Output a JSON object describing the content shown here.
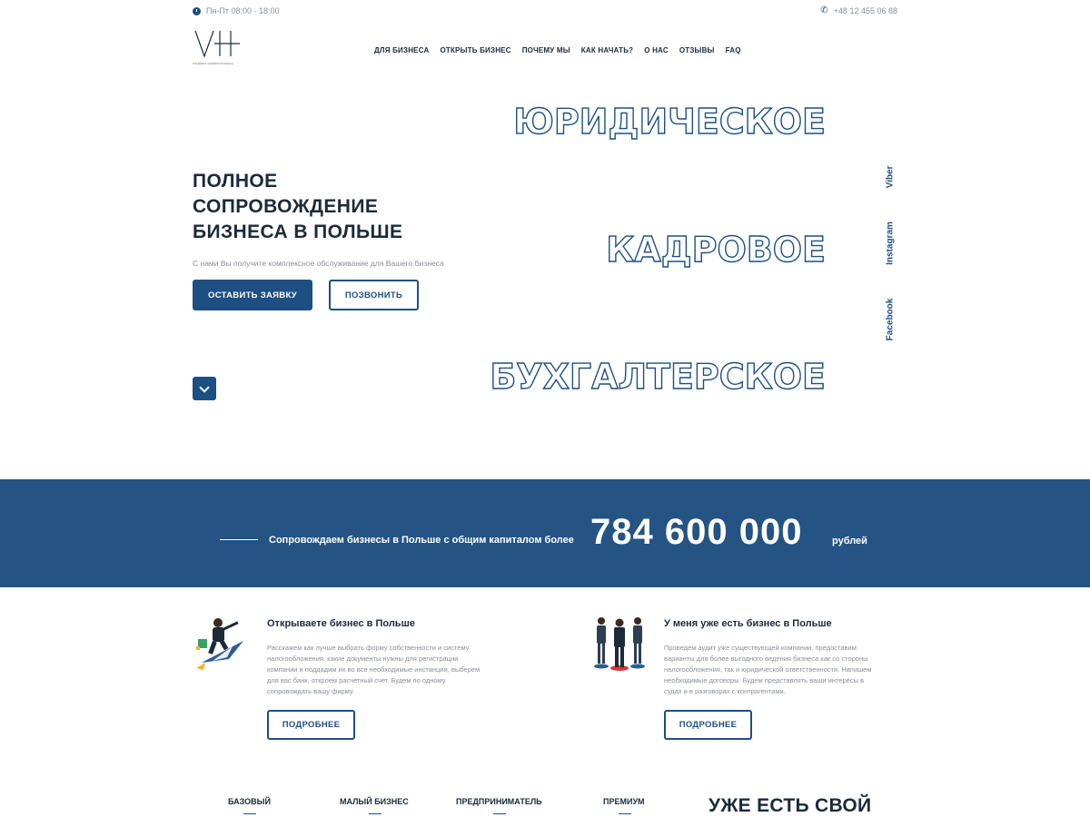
{
  "topbar": {
    "hours": "Пн-Пт 08:00 - 18:00",
    "phone": "+48 12 455 06 88"
  },
  "brand": {
    "monogram": "VH",
    "subtitle": "VALERIIA HUDZIKOVSKAIA"
  },
  "nav": {
    "items": [
      "ДЛЯ БИЗНЕСА",
      "ОТКРЫТЬ БИЗНЕС",
      "ПОЧЕМУ МЫ",
      "КАК НАЧАТЬ?",
      "О НАС",
      "ОТЗЫВЫ",
      "FAQ"
    ]
  },
  "hero": {
    "outline_words": [
      "ЮРИДИЧЕСКОЕ",
      "КАДРОВОЕ",
      "БУХГАЛТЕРСКОЕ"
    ],
    "title_lines": [
      "ПОЛНОЕ",
      "СОПРОВОЖДЕНИЕ",
      "БИЗНЕСА В ПОЛЬШЕ"
    ],
    "subtitle": "С нами Вы получите комплексное обслуживание для Вашего бизнеса",
    "primary_button": "ОСТАВИТЬ ЗАЯВКУ",
    "secondary_button": "ПОЗВОНИТЬ"
  },
  "social": [
    "Viber",
    "Instagram",
    "Facebook"
  ],
  "banner": {
    "text": "Сопровождаем бизнесы в Польше с общим капиталом более",
    "amount": "784 600 000",
    "unit": "рублей"
  },
  "services": [
    {
      "title": "Открываете бизнес в Польше",
      "body": "Расскажем как лучше выбрать форму собственности и систему налогообложения, какие документы нужны для регистрации компании и поддадим их во все необходимые инстанции, выберем для вас банк, откроем расчетный счет. Будем по одному сопровождать вашу фирму.",
      "button": "ПОДРОБНЕЕ"
    },
    {
      "title": "У меня уже есть бизнес в Польше",
      "body": "Проведем аудит уже существующей компании, предоставим варианты для более выгодного ведения бизнеса как со стороны налогообложения, так и юридической ответственности. Напишем необходимые договоры. Будем представлять ваши интересы в судах и в разговорах с контрагентами.",
      "button": "ПОДРОБНЕЕ"
    }
  ],
  "tariffs": [
    "БАЗОВЫЙ",
    "МАЛЫЙ БИЗНЕС",
    "ПРЕДПРИНИМАТЕЛЬ",
    "ПРЕМИУМ"
  ],
  "bottom_heading": "УЖЕ ЕСТЬ СВОЙ",
  "colors": {
    "primary": "#1d4f82",
    "banner": "#245384",
    "text": "#1c2a3a",
    "muted": "#8a8f96"
  }
}
